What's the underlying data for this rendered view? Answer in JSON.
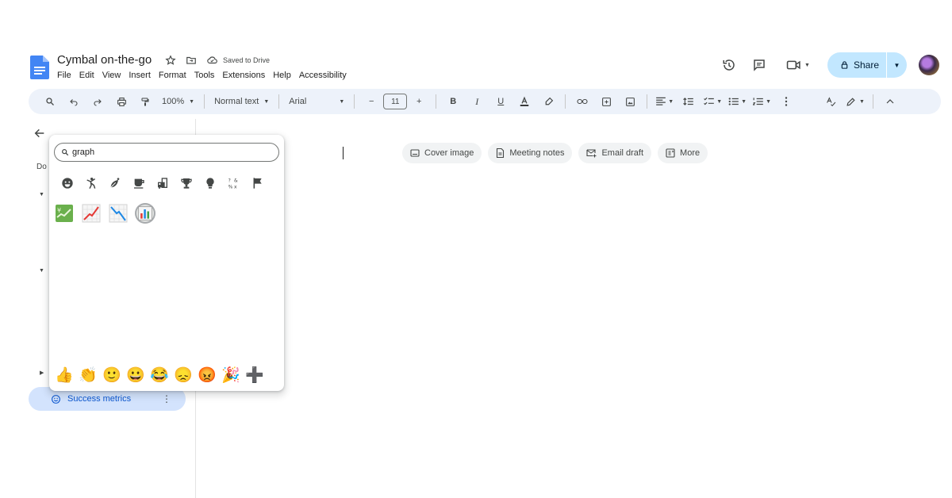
{
  "document": {
    "title": "Cymbal on-the-go",
    "save_status": "Saved to Drive"
  },
  "menu": [
    "File",
    "Edit",
    "View",
    "Insert",
    "Format",
    "Tools",
    "Extensions",
    "Help",
    "Accessibility"
  ],
  "share": {
    "label": "Share"
  },
  "toolbar": {
    "zoom": "100%",
    "style": "Normal text",
    "font": "Arial",
    "font_size": "11",
    "minus": "−",
    "plus": "+"
  },
  "sidebar": {
    "outline_label": "Do",
    "active_item": "Success metrics"
  },
  "emoji_picker": {
    "search_value": "graph",
    "reactions": [
      "👍",
      "👏",
      "🙂",
      "😀",
      "😂",
      "😞",
      "😡",
      "🎉",
      "➕"
    ]
  },
  "chips": [
    "Cover image",
    "Meeting notes",
    "Email draft",
    "More"
  ],
  "colors": {
    "toolbar_bg": "#edf2fa",
    "share_bg": "#c2e7ff",
    "active_item_bg": "#d3e3fd",
    "accent": "#0b57d0"
  }
}
